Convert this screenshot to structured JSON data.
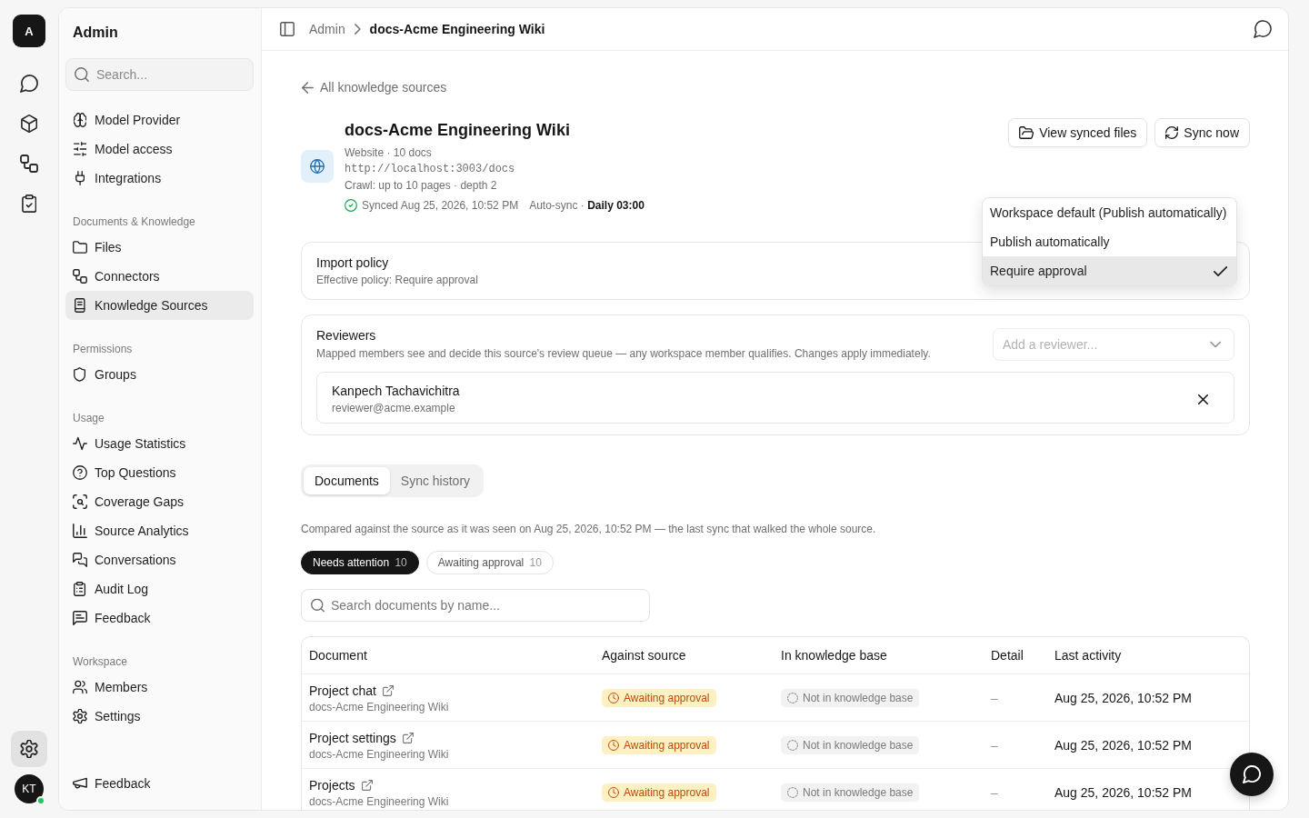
{
  "rail": {
    "workspace": "A",
    "items": [
      {
        "selected": false
      },
      {
        "selected": false
      },
      {
        "selected": false
      },
      {
        "selected": false
      }
    ],
    "settings": {
      "selected": true
    },
    "user": {
      "initials": "KT",
      "online": true
    }
  },
  "sidebar": {
    "title": "Admin",
    "search": {
      "placeholder": "Search..."
    },
    "sections": [
      {
        "items": [
          {
            "label": "Model Provider",
            "selected": false
          },
          {
            "label": "Model access",
            "selected": false
          },
          {
            "label": "Integrations",
            "selected": false
          }
        ]
      },
      {
        "heading": "Documents & Knowledge",
        "items": [
          {
            "label": "Files",
            "selected": false
          },
          {
            "label": "Connectors",
            "selected": false
          },
          {
            "label": "Knowledge Sources",
            "selected": true
          }
        ]
      },
      {
        "heading": "Permissions",
        "items": [
          {
            "label": "Groups",
            "selected": false
          }
        ]
      },
      {
        "heading": "Usage",
        "items": [
          {
            "label": "Usage Statistics",
            "selected": false
          },
          {
            "label": "Top Questions",
            "selected": false
          },
          {
            "label": "Coverage Gaps",
            "selected": false
          },
          {
            "label": "Source Analytics",
            "selected": false
          },
          {
            "label": "Conversations",
            "selected": false
          },
          {
            "label": "Audit Log",
            "selected": false
          },
          {
            "label": "Feedback",
            "selected": false
          }
        ]
      },
      {
        "heading": "Workspace",
        "items": [
          {
            "label": "Members",
            "selected": false
          },
          {
            "label": "Settings",
            "selected": false
          }
        ]
      }
    ],
    "footer": {
      "label": "Feedback"
    }
  },
  "header": {
    "breadcrumb": [
      {
        "label": "Admin",
        "current": false
      },
      {
        "label": "docs-Acme Engineering Wiki",
        "current": true
      }
    ]
  },
  "source": {
    "back_link": "All knowledge sources",
    "title": "docs-Acme Engineering Wiki",
    "meta": "Website · 10 docs",
    "url": "http://localhost:3003/docs",
    "crawl": "Crawl: up to 10 pages · depth 2",
    "sync_status": "Synced Aug 25, 2026, 10:52 PM",
    "auto_sync": "Auto-sync · **Daily 03:00**",
    "actions": [
      {
        "label": "View synced files"
      },
      {
        "label": "Sync now"
      }
    ]
  },
  "import_policy": {
    "title": "Import policy",
    "description": "Effective policy: Require approval",
    "menu": {
      "options": [
        {
          "label": "Workspace default (Publish automatically)",
          "selected": false
        },
        {
          "label": "Publish automatically",
          "selected": false
        },
        {
          "label": "Require approval",
          "selected": true
        }
      ]
    }
  },
  "reviewers": {
    "title": "Reviewers",
    "description": "Mapped members see and decide this source's review queue — any workspace member qualifies. Changes apply immediately.",
    "add": {
      "placeholder": "Add a reviewer..."
    },
    "members": [
      {
        "name": "Kanpech Tachavichitra",
        "email": "reviewer@acme.example"
      }
    ]
  },
  "tabs": [
    {
      "label": "Documents",
      "selected": true
    },
    {
      "label": "Sync history",
      "selected": false
    }
  ],
  "documents": {
    "note": "Compared against the source as it was seen on Aug 25, 2026, 10:52 PM — the last sync that walked the whole source.",
    "filters": [
      {
        "label": "Needs attention",
        "count": "10",
        "selected": true
      },
      {
        "label": "Awaiting approval",
        "count": "10",
        "selected": false
      }
    ],
    "search": {
      "placeholder": "Search documents by name..."
    },
    "table": {
      "columns": [
        "Document",
        "Against source",
        "In knowledge base",
        "Detail",
        "Last activity"
      ],
      "rows": [
        {
          "name": "Project chat",
          "source": "docs-Acme Engineering Wiki",
          "against_source": {
            "label": "Awaiting approval",
            "kind": "awaiting"
          },
          "in_knowledge_base": {
            "label": "Not in knowledge base",
            "kind": "absent"
          },
          "detail": "–",
          "last_activity": "Aug 25, 2026, 10:52 PM"
        },
        {
          "name": "Project settings",
          "source": "docs-Acme Engineering Wiki",
          "against_source": {
            "label": "Awaiting approval",
            "kind": "awaiting"
          },
          "in_knowledge_base": {
            "label": "Not in knowledge base",
            "kind": "absent"
          },
          "detail": "–",
          "last_activity": "Aug 25, 2026, 10:52 PM"
        },
        {
          "name": "Projects",
          "source": "docs-Acme Engineering Wiki",
          "against_source": {
            "label": "Awaiting approval",
            "kind": "awaiting"
          },
          "in_knowledge_base": {
            "label": "Not in knowledge base",
            "kind": "absent"
          },
          "detail": "–",
          "last_activity": "Aug 25, 2026, 10:52 PM"
        }
      ]
    }
  }
}
